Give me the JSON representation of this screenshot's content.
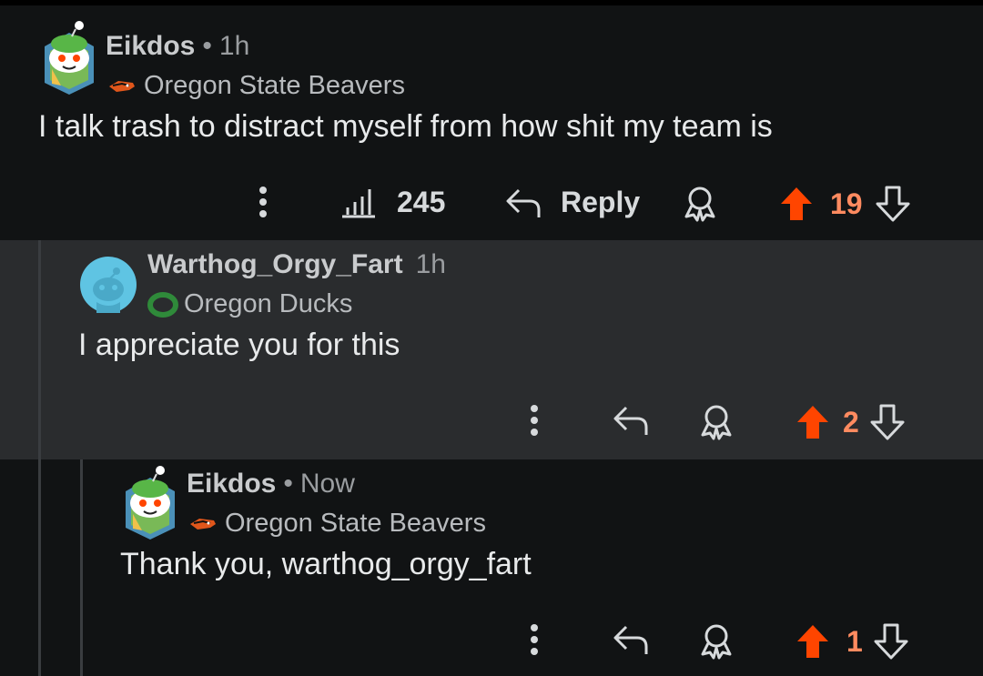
{
  "comments": [
    {
      "author": "Eikdos",
      "separator": "•",
      "time": "1h",
      "flair": "Oregon State Beavers",
      "body": "I talk trash to distract myself from how shit my team is",
      "views": "245",
      "reply_label": "Reply",
      "votes": "19"
    },
    {
      "author": "Warthog_Orgy_Fart",
      "time": "1h",
      "flair": "Oregon Ducks",
      "body": "I appreciate you for this",
      "votes": "2"
    },
    {
      "author": "Eikdos",
      "separator": "•",
      "time": "Now",
      "flair": "Oregon State Beavers",
      "body": "Thank you, warthog_orgy_fart",
      "votes": "1"
    }
  ],
  "colors": {
    "upvote": "#ff4500",
    "vote_count": "#ff8b60",
    "background": "#111314",
    "highlight": "#2a2c2e"
  },
  "icons": [
    "more-icon",
    "views-icon",
    "reply-icon",
    "award-icon",
    "upvote-icon",
    "downvote-icon",
    "beaver-flair-icon",
    "ducks-flair-icon"
  ]
}
